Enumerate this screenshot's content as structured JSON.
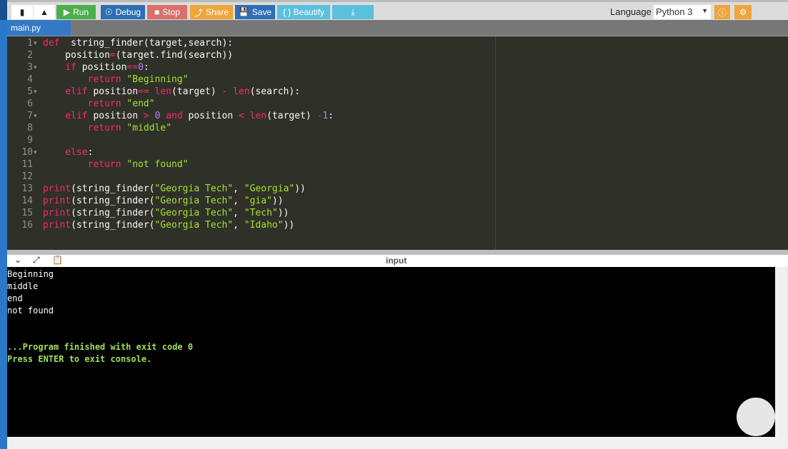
{
  "toolbar": {
    "run": "Run",
    "debug": "Debug",
    "stop": "Stop",
    "share": "Share",
    "save": "Save",
    "beautify": "{ } Beautify",
    "language_label": "Language",
    "language_value": "Python 3"
  },
  "tab": "main.py",
  "code": [
    [
      [
        "k",
        "def"
      ],
      [
        "",
        "  string_finder(target,search):"
      ]
    ],
    [
      [
        "",
        "    position"
      ],
      [
        "o",
        "="
      ],
      [
        "",
        "(target.find(search))"
      ]
    ],
    [
      [
        "",
        "    "
      ],
      [
        "k",
        "if"
      ],
      [
        "",
        " position"
      ],
      [
        "o",
        "=="
      ],
      [
        "n",
        "0"
      ],
      [
        "",
        ":"
      ]
    ],
    [
      [
        "",
        "        "
      ],
      [
        "k",
        "return"
      ],
      [
        "",
        ""
      ],
      [
        "s",
        " \"Beginning\""
      ]
    ],
    [
      [
        "",
        "    "
      ],
      [
        "k",
        "elif"
      ],
      [
        "",
        " position"
      ],
      [
        "o",
        "=="
      ],
      [
        "",
        " "
      ],
      [
        "b",
        "len"
      ],
      [
        "",
        "(target) "
      ],
      [
        "o",
        "-"
      ],
      [
        "",
        " "
      ],
      [
        "b",
        "len"
      ],
      [
        "",
        "(search):"
      ]
    ],
    [
      [
        "",
        "        "
      ],
      [
        "k",
        "return"
      ],
      [
        "s",
        " \"end\""
      ]
    ],
    [
      [
        "",
        "    "
      ],
      [
        "k",
        "elif"
      ],
      [
        "",
        " position "
      ],
      [
        "o",
        ">"
      ],
      [
        "",
        " "
      ],
      [
        "n",
        "0"
      ],
      [
        "",
        " "
      ],
      [
        "k",
        "and"
      ],
      [
        "",
        " position "
      ],
      [
        "o",
        "<"
      ],
      [
        "",
        " "
      ],
      [
        "b",
        "len"
      ],
      [
        "",
        "(target) "
      ],
      [
        "o",
        "-"
      ],
      [
        "n",
        "1"
      ],
      [
        "",
        ":"
      ]
    ],
    [
      [
        "",
        "        "
      ],
      [
        "k",
        "return"
      ],
      [
        "s",
        " \"middle\""
      ]
    ],
    [],
    [
      [
        "",
        "    "
      ],
      [
        "k",
        "else"
      ],
      [
        "",
        ":"
      ]
    ],
    [
      [
        "",
        "        "
      ],
      [
        "k",
        "return"
      ],
      [
        "s",
        " \"not found\""
      ]
    ],
    [],
    [
      [
        "k",
        "print"
      ],
      [
        "",
        "(string_finder("
      ],
      [
        "s",
        "\"Georgia Tech\""
      ],
      [
        "",
        ", "
      ],
      [
        "s",
        "\"Georgia\""
      ],
      [
        "",
        "))"
      ]
    ],
    [
      [
        "k",
        "print"
      ],
      [
        "",
        "(string_finder("
      ],
      [
        "s",
        "\"Georgia Tech\""
      ],
      [
        "",
        ", "
      ],
      [
        "s",
        "\"gia\""
      ],
      [
        "",
        "))"
      ]
    ],
    [
      [
        "k",
        "print"
      ],
      [
        "",
        "(string_finder("
      ],
      [
        "s",
        "\"Georgia Tech\""
      ],
      [
        "",
        ", "
      ],
      [
        "s",
        "\"Tech\""
      ],
      [
        "",
        "))"
      ]
    ],
    [
      [
        "k",
        "print"
      ],
      [
        "",
        "(string_finder("
      ],
      [
        "s",
        "\"Georgia Tech\""
      ],
      [
        "",
        ", "
      ],
      [
        "s",
        "\"Idaho\""
      ],
      [
        "",
        "))"
      ]
    ]
  ],
  "folds": [
    1,
    3,
    5,
    7,
    10
  ],
  "console_header": "input",
  "output": [
    "Beginning",
    "middle",
    "end",
    "not found",
    "",
    "",
    "...Program finished with exit code 0",
    "Press ENTER to exit console."
  ]
}
